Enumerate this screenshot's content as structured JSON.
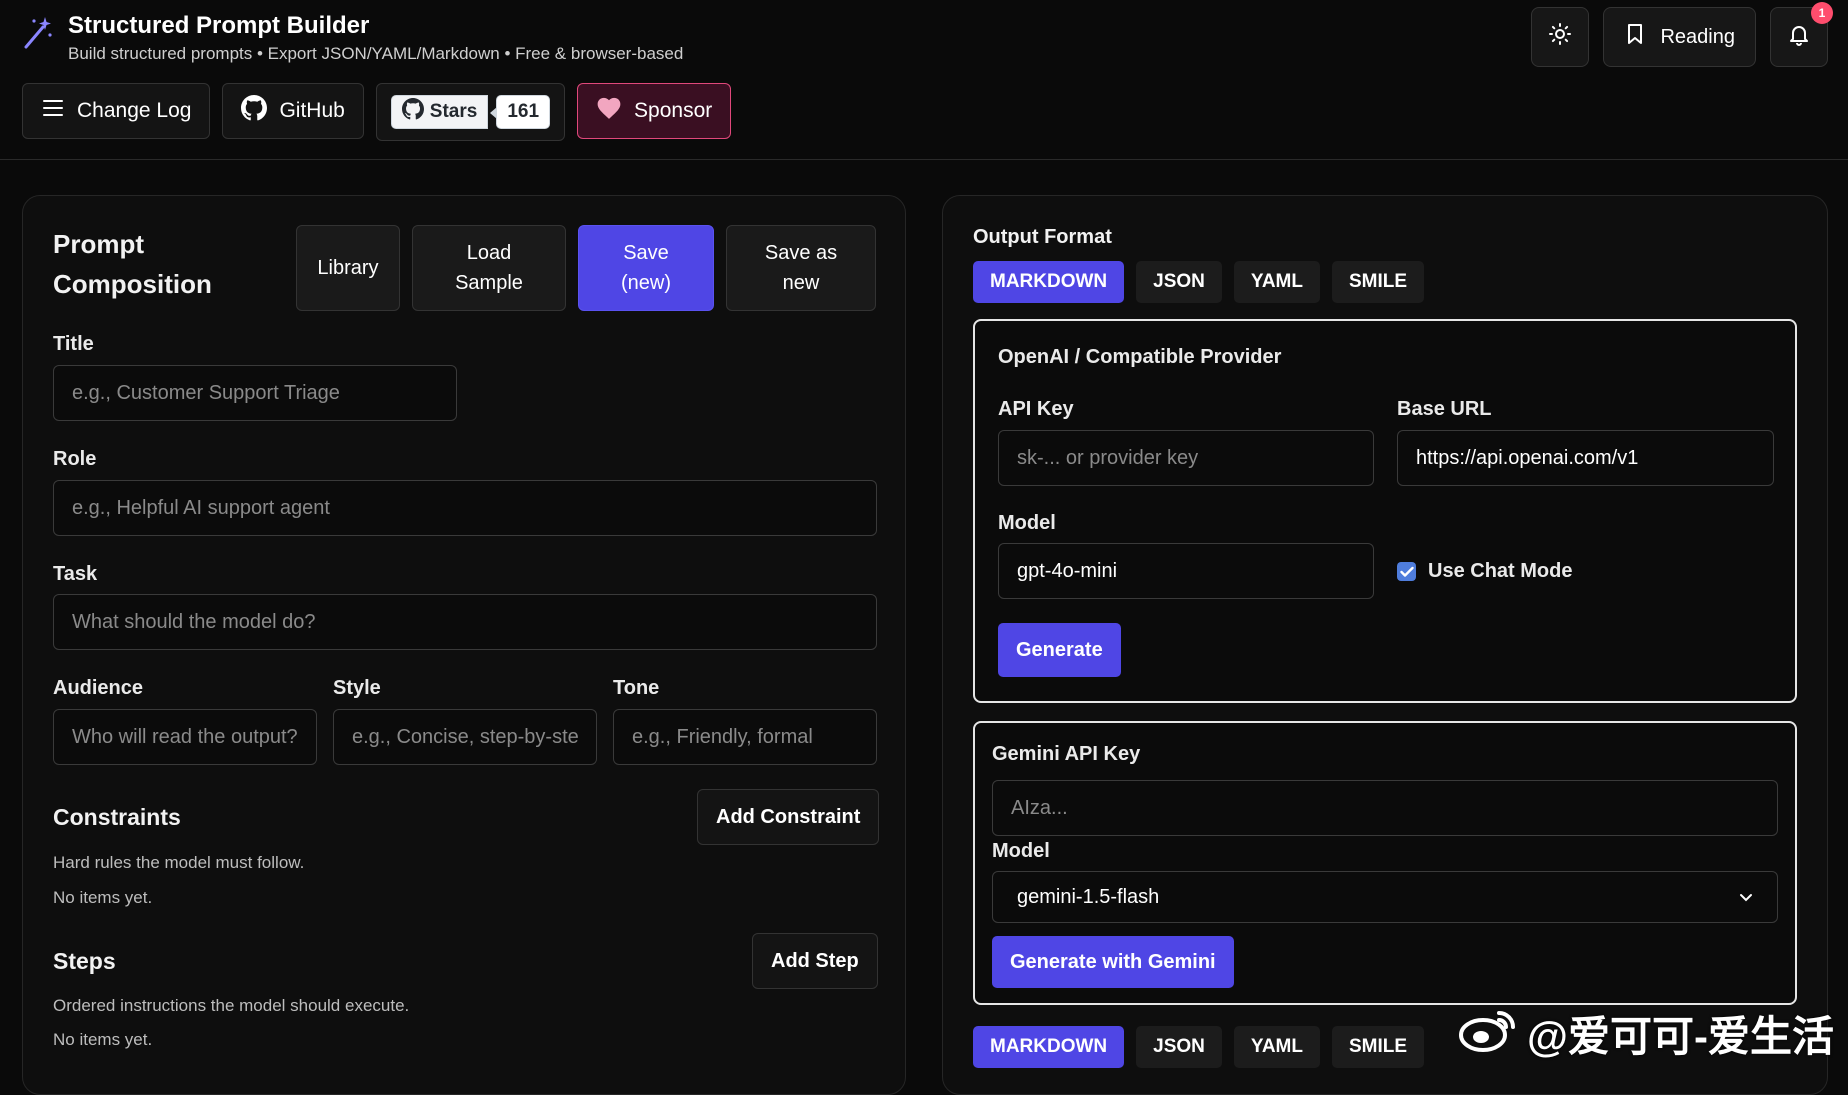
{
  "app": {
    "title": "Structured Prompt Builder",
    "subtitle": "Build structured prompts • Export JSON/YAML/Markdown • Free & browser-based"
  },
  "top_actions": {
    "theme_icon": "sun-icon",
    "reading_label": "Reading",
    "reading_icon": "bookmark-icon",
    "bell_icon": "bell-icon",
    "notification_count": "1"
  },
  "nav": {
    "changelog_label": "Change Log",
    "github_label": "GitHub",
    "stars_label": "Stars",
    "stars_count": "161",
    "sponsor_label": "Sponsor"
  },
  "composition": {
    "title": "Prompt Composition",
    "library_label": "Library",
    "load_sample_label": "Load Sample",
    "save_new_label": "Save (new)",
    "save_as_new_label": "Save as new",
    "title_label": "Title",
    "title_placeholder": "e.g., Customer Support Triage",
    "role_label": "Role",
    "role_placeholder": "e.g., Helpful AI support agent",
    "task_label": "Task",
    "task_placeholder": "What should the model do?",
    "audience_label": "Audience",
    "audience_placeholder": "Who will read the output?",
    "style_label": "Style",
    "style_placeholder": "e.g., Concise, step-by-step",
    "tone_label": "Tone",
    "tone_placeholder": "e.g., Friendly, formal",
    "constraints_title": "Constraints",
    "constraints_desc": "Hard rules the model must follow.",
    "constraints_empty": "No items yet.",
    "add_constraint_label": "Add Constraint",
    "steps_title": "Steps",
    "steps_desc": "Ordered instructions the model should execute.",
    "steps_empty": "No items yet.",
    "add_step_label": "Add Step"
  },
  "output": {
    "format_label": "Output Format",
    "tabs": [
      "MARKDOWN",
      "JSON",
      "YAML",
      "SMILE"
    ],
    "active_tab": "MARKDOWN"
  },
  "openai": {
    "title": "OpenAI / Compatible Provider",
    "api_key_label": "API Key",
    "api_key_placeholder": "sk-... or provider key",
    "base_url_label": "Base URL",
    "base_url_value": "https://api.openai.com/v1",
    "model_label": "Model",
    "model_value": "gpt-4o-mini",
    "chat_mode_label": "Use Chat Mode",
    "chat_mode_checked": true,
    "generate_label": "Generate"
  },
  "gemini": {
    "title": "Gemini API Key",
    "api_key_placeholder": "AIza...",
    "model_label": "Model",
    "model_value": "gemini-1.5-flash",
    "generate_label": "Generate with Gemini"
  },
  "bottom_tabs": [
    "MARKDOWN",
    "JSON",
    "YAML",
    "SMILE"
  ],
  "watermark": "@爱可可-爱生活",
  "colors": {
    "accent": "#4f46e5",
    "background": "#0a0a0a",
    "sponsor_border": "#e0487b"
  }
}
